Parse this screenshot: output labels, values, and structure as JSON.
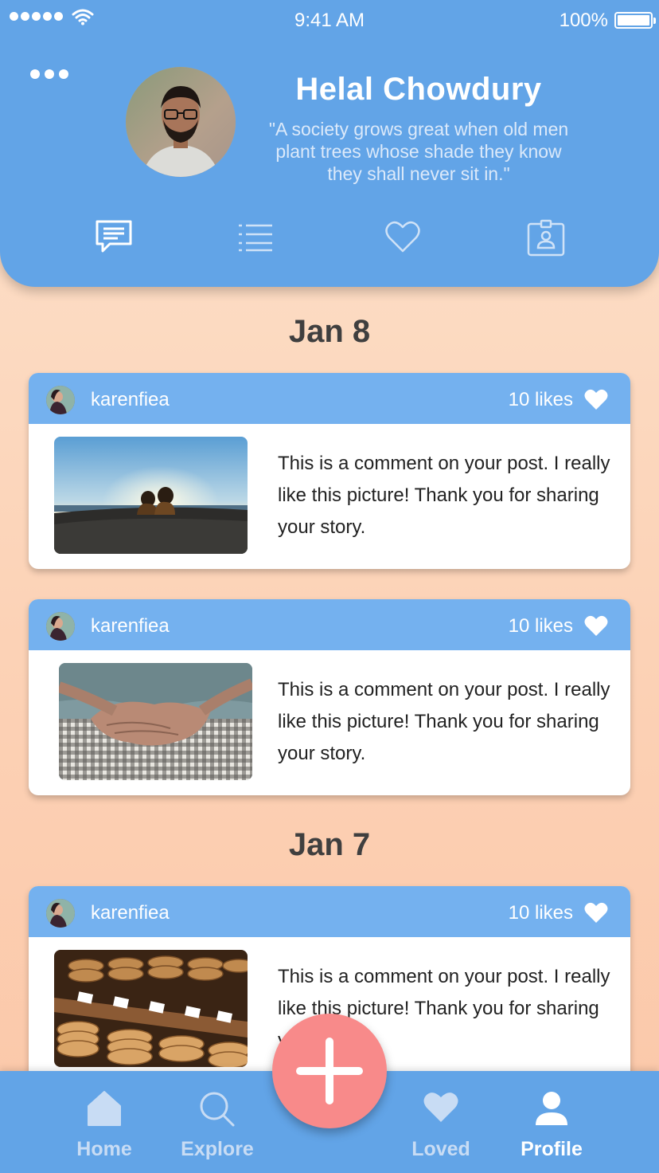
{
  "status_bar": {
    "time": "9:41 AM",
    "battery": "100%"
  },
  "profile": {
    "name": "Helal Chowdury",
    "quote": "\"A society grows great when old men plant trees whose shade they know they shall never sit in.\""
  },
  "profile_tabs": [
    {
      "icon": "comment-icon",
      "active": true
    },
    {
      "icon": "list-icon",
      "active": false
    },
    {
      "icon": "heart-outline-icon",
      "active": false
    },
    {
      "icon": "contact-card-icon",
      "active": false
    }
  ],
  "groups": [
    {
      "date": "Jan 8"
    },
    {
      "date": "Jan 7"
    }
  ],
  "posts": [
    {
      "user": "karenfiea",
      "likes": "10 likes",
      "photo": "sunset-couple-photo",
      "comment": "This is a comment on your post. I really like this picture! Thank you for sharing your story."
    },
    {
      "user": "karenfiea",
      "likes": "10 likes",
      "photo": "hands-photo",
      "comment": "This is a comment on your post. I really like this picture! Thank you for sharing your story."
    },
    {
      "user": "karenfiea",
      "likes": "10 likes",
      "photo": "cookies-photo",
      "comment": "This is a comment on your post. I really like this picture! Thank you for sharing your story."
    }
  ],
  "bottom_nav": {
    "home": "Home",
    "explore": "Explore",
    "loved": "Loved",
    "profile": "Profile",
    "active": "profile"
  },
  "colors": {
    "header_blue": "#62a4e7",
    "card_header_blue": "#74b1ef",
    "fab_pink": "#f88a8a",
    "background_peach": "#fcd2b6"
  }
}
